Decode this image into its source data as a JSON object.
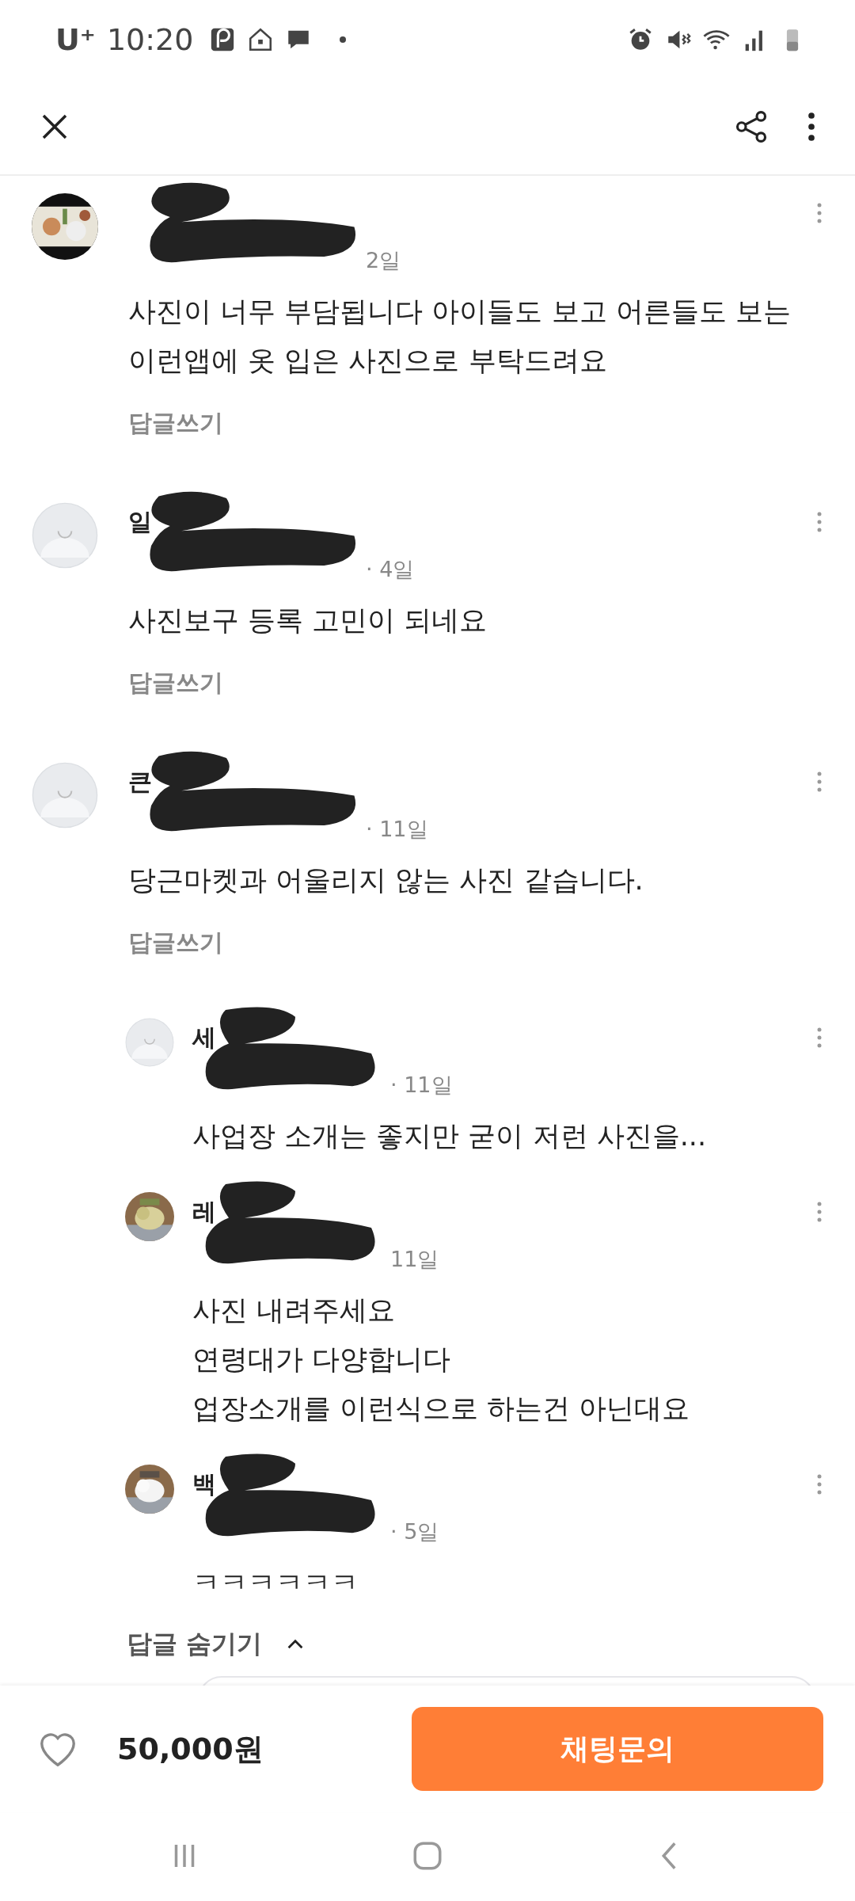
{
  "status_bar": {
    "carrier": "U⁺",
    "time": "10:20"
  },
  "comments": [
    {
      "avatar": {
        "kind": "picture"
      },
      "meta": "2일",
      "redacted": true,
      "lines": [
        "사진이 너무 부담됩니다 아이들도 보고 어른들도 보는",
        "이런앱에 옷 입은 사진으로 부탁드려요"
      ],
      "reply_link": "답글쓰기"
    },
    {
      "avatar": {
        "kind": "default"
      },
      "name": "일",
      "meta": "· 4일",
      "redacted": true,
      "lines": [
        "사진보구 등록 고민이 되네요"
      ],
      "reply_link": "답글쓰기"
    },
    {
      "avatar": {
        "kind": "default"
      },
      "name": "큰",
      "meta": "· 11일",
      "redacted": true,
      "lines": [
        "당근마켓과 어울리지 않는 사진 같습니다."
      ],
      "reply_link": "답글쓰기",
      "replies": [
        {
          "avatar": {
            "kind": "default"
          },
          "name": "세",
          "meta": "· 11일",
          "redacted": true,
          "lines": [
            "사업장 소개는 좋지만 굳이 저런 사진을..."
          ]
        },
        {
          "avatar": {
            "kind": "picture"
          },
          "name": "레",
          "meta": "11일",
          "redacted": true,
          "lines": [
            "사진 내려주세요",
            "연령대가 다양합니다",
            "업장소개를 이런식으로 하는건 아닌대요"
          ]
        },
        {
          "avatar": {
            "kind": "picture"
          },
          "name": "백",
          "meta": "· 5일",
          "redacted": true,
          "lines": [
            "ㅋㅋㅋㅋㅋㅋ"
          ]
        }
      ],
      "hide_replies": "답글 숨기기"
    }
  ],
  "bottom_bar": {
    "liked": false,
    "price": "50,000원",
    "chat_button": "채팅문의"
  }
}
